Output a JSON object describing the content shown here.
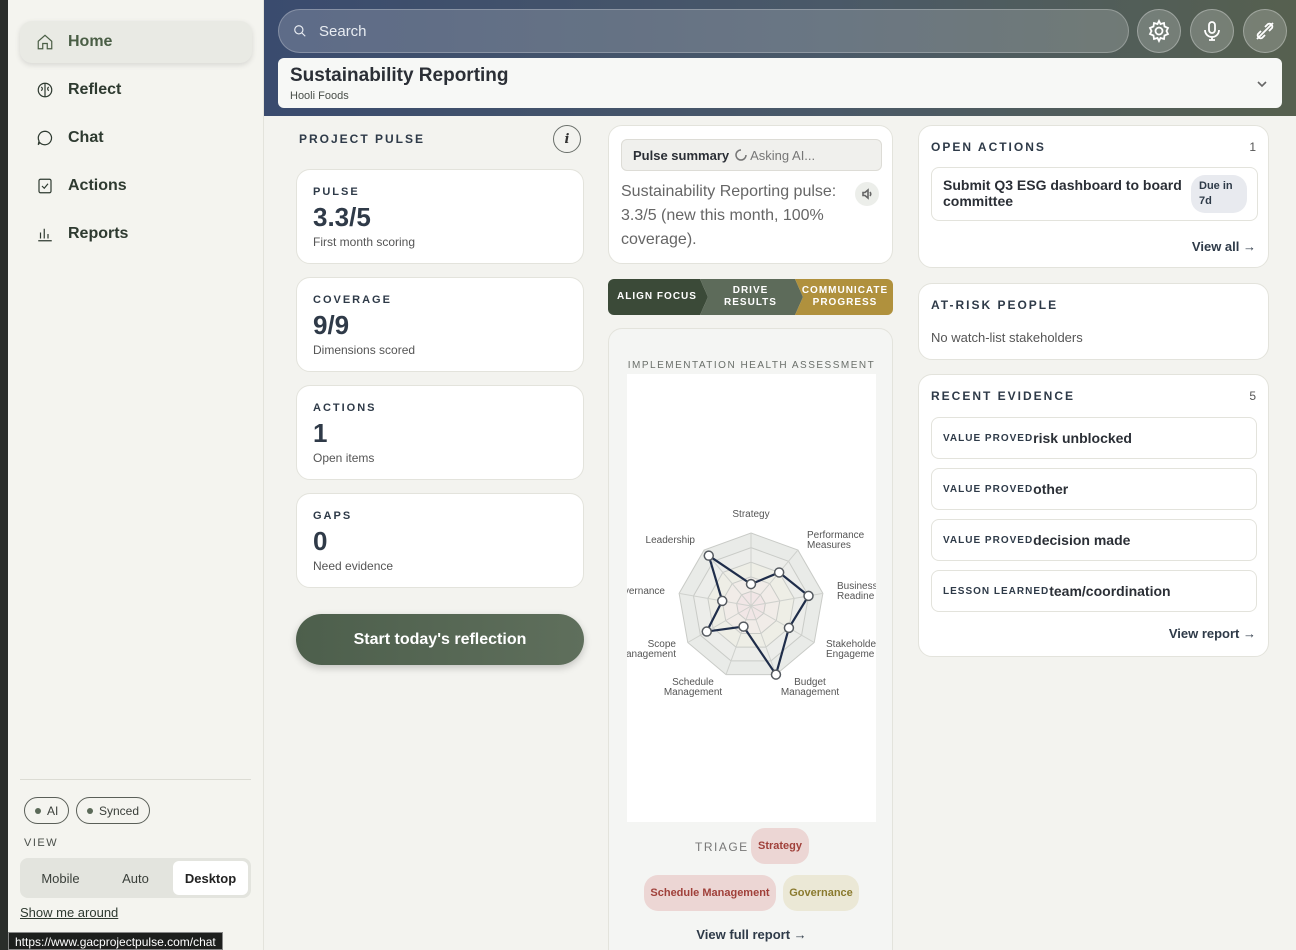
{
  "sidebar": {
    "items": [
      {
        "label": "Home",
        "icon": "home-icon"
      },
      {
        "label": "Reflect",
        "icon": "brain-icon"
      },
      {
        "label": "Chat",
        "icon": "chat-bubble-icon"
      },
      {
        "label": "Actions",
        "icon": "checkbox-icon"
      },
      {
        "label": "Reports",
        "icon": "bar-chart-icon"
      }
    ],
    "pills": [
      "AI",
      "Synced"
    ],
    "view_label": "VIEW",
    "view_options": [
      "Mobile",
      "Auto",
      "Desktop"
    ],
    "view_selected": "Desktop",
    "show_around": "Show me around"
  },
  "status_url": "https://www.gacprojectpulse.com/chat",
  "header": {
    "search_placeholder": "Search",
    "project_title": "Sustainability Reporting",
    "project_org": "Hooli Foods"
  },
  "pulse": {
    "heading": "PROJECT PULSE",
    "info": "i",
    "stats": [
      {
        "label": "PULSE",
        "value": "3.3/5",
        "desc": "First month scoring"
      },
      {
        "label": "COVERAGE",
        "value": "9/9",
        "desc": "Dimensions scored"
      },
      {
        "label": "ACTIONS",
        "value": "1",
        "desc": "Open items"
      },
      {
        "label": "GAPS",
        "value": "0",
        "desc": "Need evidence"
      }
    ],
    "start_button": "Start today's reflection"
  },
  "summary": {
    "tab_label": "Pulse summary",
    "asking": "Asking AI...",
    "text": "Sustainability Reporting pulse: 3.3/5 (new this month, 100% coverage)."
  },
  "steps": [
    {
      "label": "ALIGN FOCUS",
      "color": "#3b4a38"
    },
    {
      "label": "DRIVE RESULTS",
      "color": "#5d6b5a"
    },
    {
      "label": "COMMUNICATE PROGRESS",
      "color": "#b0913d"
    }
  ],
  "chart_data": {
    "type": "radar",
    "title": "IMPLEMENTATION HEALTH ASSESSMENT",
    "categories": [
      "Strategy",
      "Performance Measures",
      "Business Readiness",
      "Stakeholder Engagement",
      "Budget Management",
      "Schedule Management",
      "Scope Management",
      "Governance",
      "Leadership"
    ],
    "visible_category_labels": [
      "Strategy",
      "Performance Measures",
      "Business Readine",
      "Stakeholde Engageme",
      "Budget Management",
      "Schedule Management",
      "Scope anagement",
      "vernance",
      "Leadership"
    ],
    "values": [
      1.5,
      3.0,
      4.0,
      3.0,
      5.0,
      1.5,
      3.5,
      2.0,
      4.5
    ],
    "rlim": [
      0,
      5
    ],
    "rings": 5,
    "line_color": "#1f2d4a"
  },
  "triage": {
    "label": "TRIAGE",
    "chips": [
      {
        "label": "Strategy",
        "bg": "#ecd6d4",
        "fg": "#a0403a"
      },
      {
        "label": "Schedule Management",
        "bg": "#ecd6d4",
        "fg": "#a0403a"
      },
      {
        "label": "Governance",
        "bg": "#ebe8d6",
        "fg": "#8a7a2e"
      }
    ],
    "full_report": "View full report →"
  },
  "open_actions": {
    "heading": "OPEN ACTIONS",
    "count": "1",
    "item": "Submit Q3 ESG dashboard to board committee",
    "due": "Due in 7d",
    "view_all": "View all →"
  },
  "at_risk": {
    "heading": "AT-RISK PEOPLE",
    "text": "No watch-list stakeholders"
  },
  "evidence": {
    "heading": "RECENT EVIDENCE",
    "count": "5",
    "items": [
      {
        "tag": "VALUE PROVED",
        "value": "risk unblocked"
      },
      {
        "tag": "VALUE PROVED",
        "value": "other"
      },
      {
        "tag": "VALUE PROVED",
        "value": "decision made"
      },
      {
        "tag": "LESSON LEARNED",
        "value": "team/coordination"
      }
    ],
    "view_report": "View report →"
  }
}
